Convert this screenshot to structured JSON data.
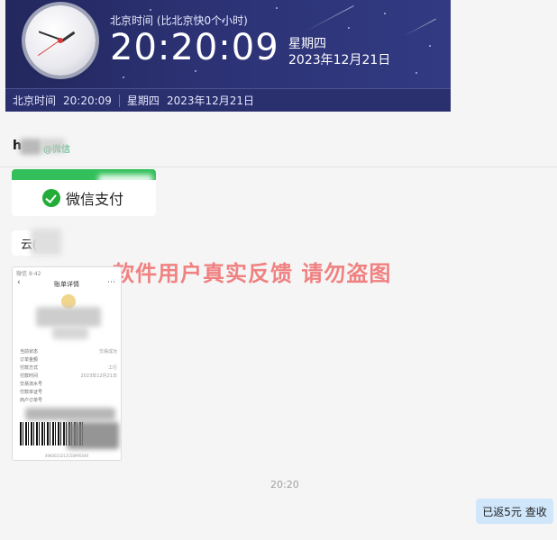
{
  "clock_banner": {
    "zone_label": "北京时间 (比北京快0个小时)",
    "time": "20:20:09",
    "weekday": "星期四",
    "date": "2023年12月21日",
    "status": {
      "zone": "北京时间",
      "time": "20:20:09",
      "weekday": "星期四",
      "date": "2023年12月21日"
    }
  },
  "chat": {
    "contact_name": "h",
    "contact_tag": "@微信",
    "pay_card": {
      "label": "微信支付",
      "accent": "#33c05a"
    },
    "short_message": "云(",
    "watermark": "软件用户真实反馈  请勿盗图",
    "screenshot_thumb": {
      "status_text": "微信 9:42",
      "title": "账单详情",
      "rows": [
        {
          "k": "当前状态",
          "v": "交易成功"
        },
        {
          "k": "订单金额",
          "v": ""
        },
        {
          "k": "付款方式",
          "v": "工行"
        },
        {
          "k": "付款时间",
          "v": "2023年12月21日"
        },
        {
          "k": "交易流水号",
          "v": ""
        },
        {
          "k": "付款单证号",
          "v": ""
        },
        {
          "k": "商户订单号",
          "v": ""
        }
      ],
      "footer": "4960023212158995040"
    },
    "timestamp": "20:20",
    "reply": "已返5元 查收",
    "reply_color": "#cfe6fb"
  }
}
